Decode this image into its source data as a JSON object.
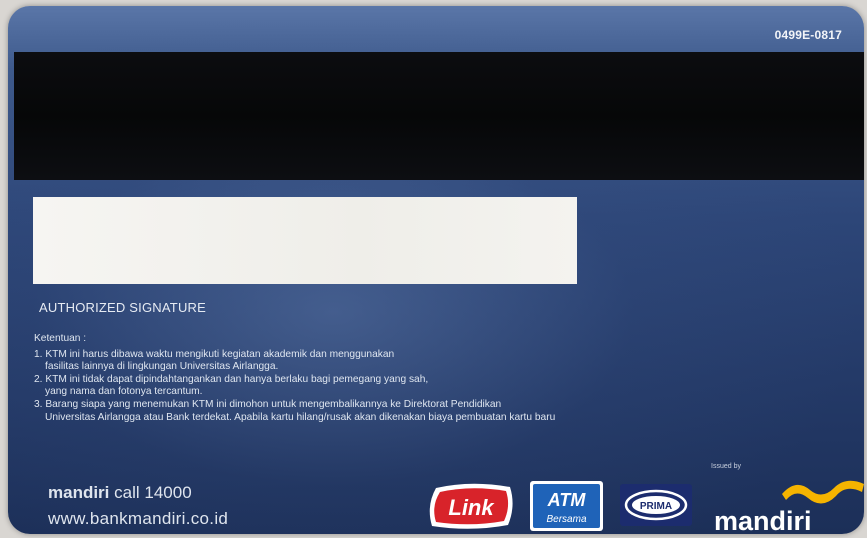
{
  "card": {
    "serial": "0499E-0817",
    "signature_label": "AUTHORIZED SIGNATURE",
    "terms_heading": "Ketentuan :",
    "terms": [
      {
        "line1": "1. KTM ini harus dibawa waktu mengikuti kegiatan akademik dan menggunakan",
        "line2": "fasilitas lainnya di lingkungan Universitas Airlangga."
      },
      {
        "line1": "2. KTM ini tidak dapat dipindahtangankan dan hanya berlaku bagi pemegang yang sah,",
        "line2": "yang nama dan fotonya tercantum."
      },
      {
        "line1": "3. Barang siapa yang menemukan KTM ini dimohon untuk mengembalikannya ke Direktorat Pendidikan",
        "line2": "Universitas Airlangga atau Bank terdekat. Apabila kartu hilang/rusak akan dikenakan biaya pembuatan kartu baru"
      }
    ],
    "issued_by": "Issued by",
    "footer": {
      "brand": "mandiri",
      "call": "call 14000",
      "website": "www.bankmandiri.co.id"
    },
    "logos": {
      "link": "Link",
      "atm_top": "ATM",
      "atm_bottom": "Bersama",
      "prima": "PRIMA",
      "mandiri": "mandiri"
    },
    "colors": {
      "link_red": "#d8232a",
      "atm_blue": "#1f63b8",
      "prima_navy": "#1c2c6e",
      "mandiri_gold": "#f5b400"
    }
  }
}
